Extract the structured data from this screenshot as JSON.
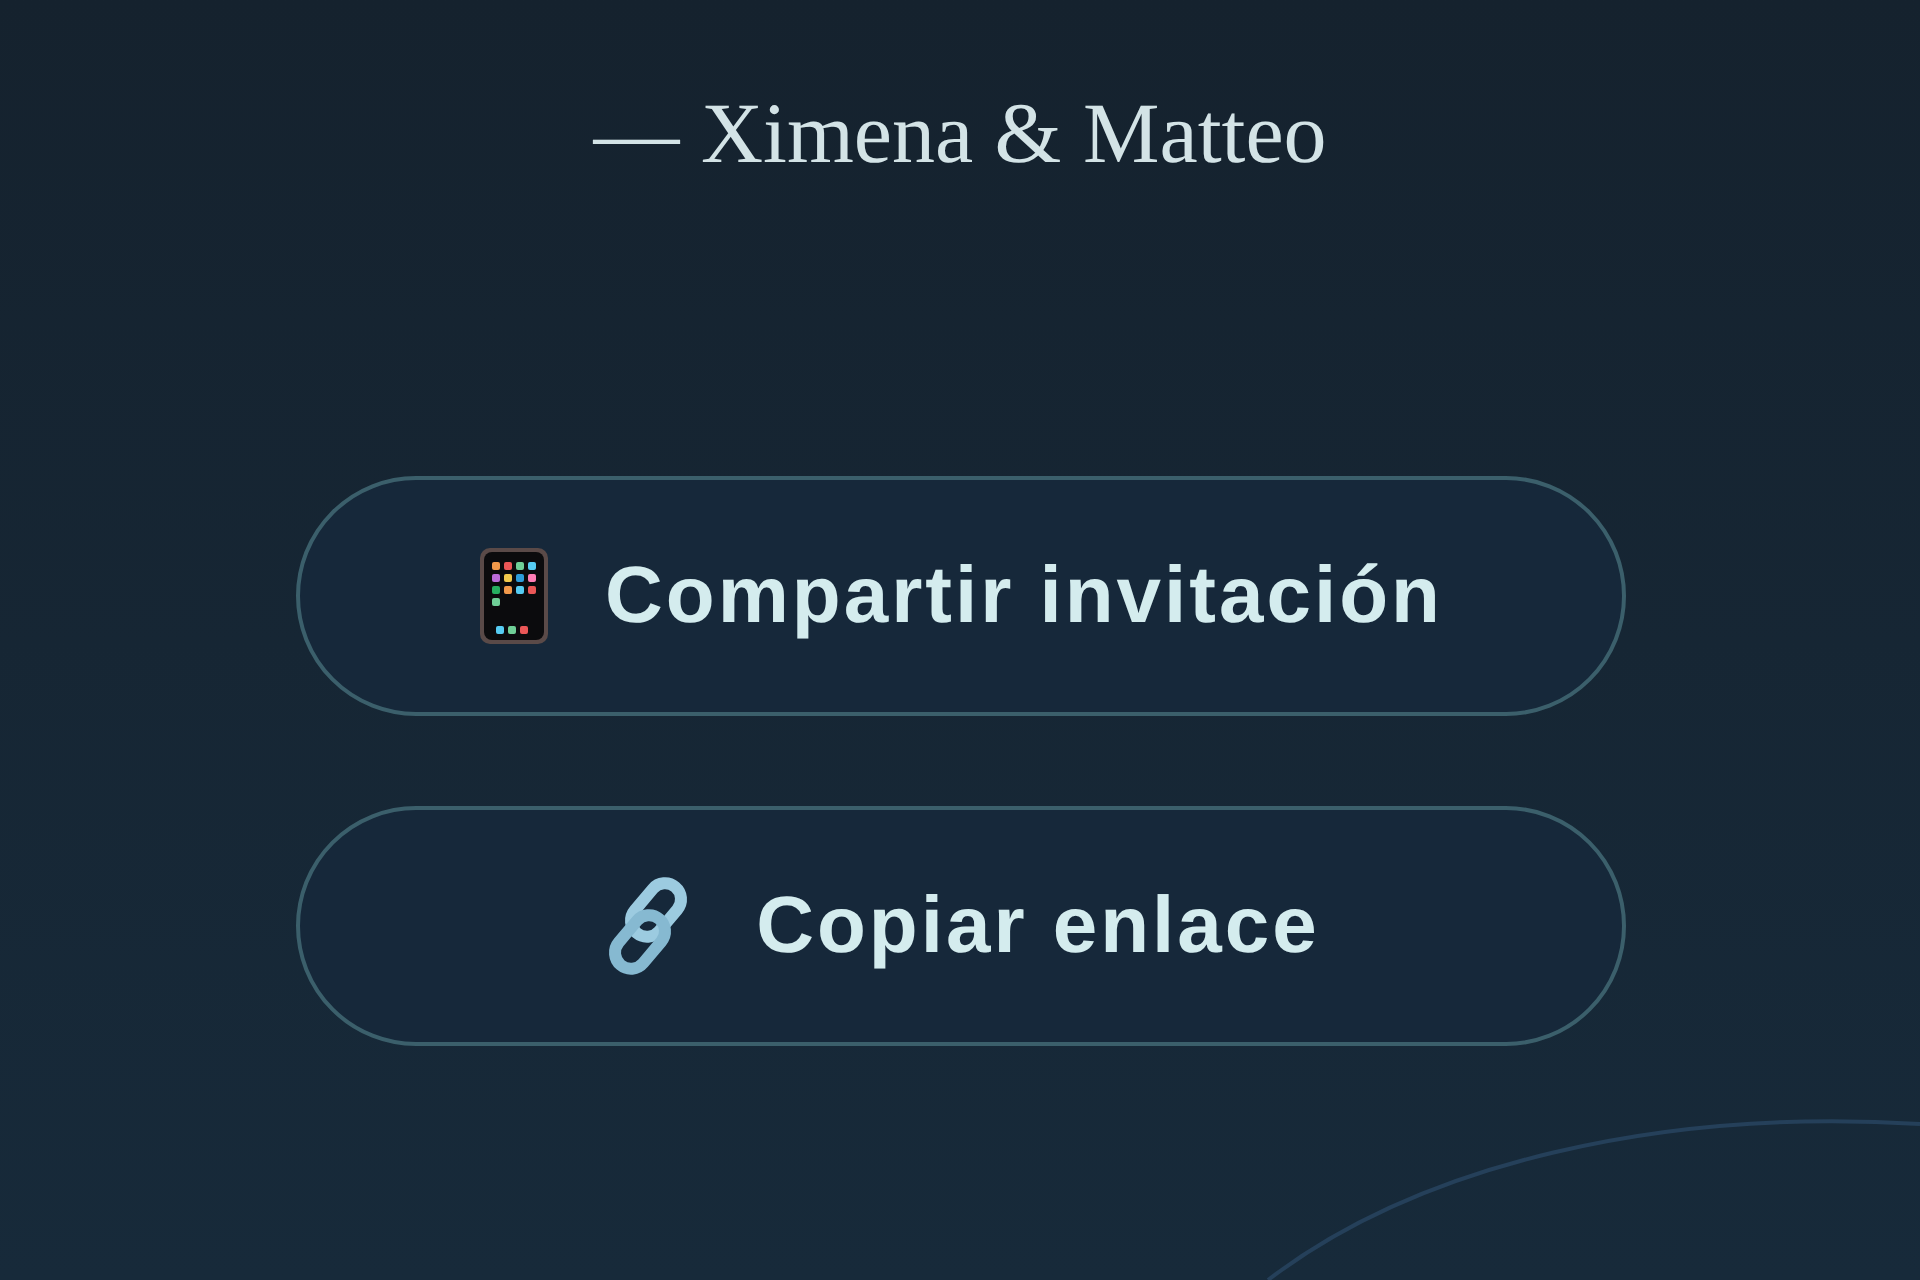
{
  "signature": {
    "text": "— Ximena & Matteo"
  },
  "buttons": [
    {
      "kind": "phone",
      "label": "Compartir invitación"
    },
    {
      "kind": "link",
      "label": "Copiar enlace"
    }
  ]
}
